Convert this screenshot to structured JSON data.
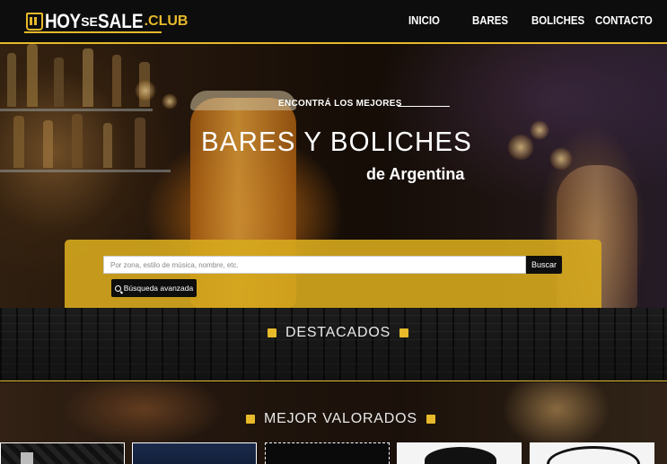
{
  "brand": {
    "hoy": "HOY",
    "se": "SE",
    "sale": "SALE",
    "club": ".CLUB",
    "accent_color": "#e7b92b"
  },
  "nav": {
    "items": [
      "INICIO",
      "BARES",
      "BOLICHES",
      "CONTACTO"
    ]
  },
  "hero": {
    "kicker": "ENCONTRÁ LOS MEJORES",
    "title": "BARES Y BOLICHES",
    "subtitle": "de Argentina"
  },
  "search": {
    "placeholder": "Por zona, estilo de música, nombre, etc.",
    "button_label": "Buscar",
    "advanced_label": "Búsqueda avanzada",
    "advanced_icon": "search-icon"
  },
  "sections": {
    "featured_title": "DESTACADOS",
    "top_rated_title": "MEJOR VALORADOS"
  }
}
